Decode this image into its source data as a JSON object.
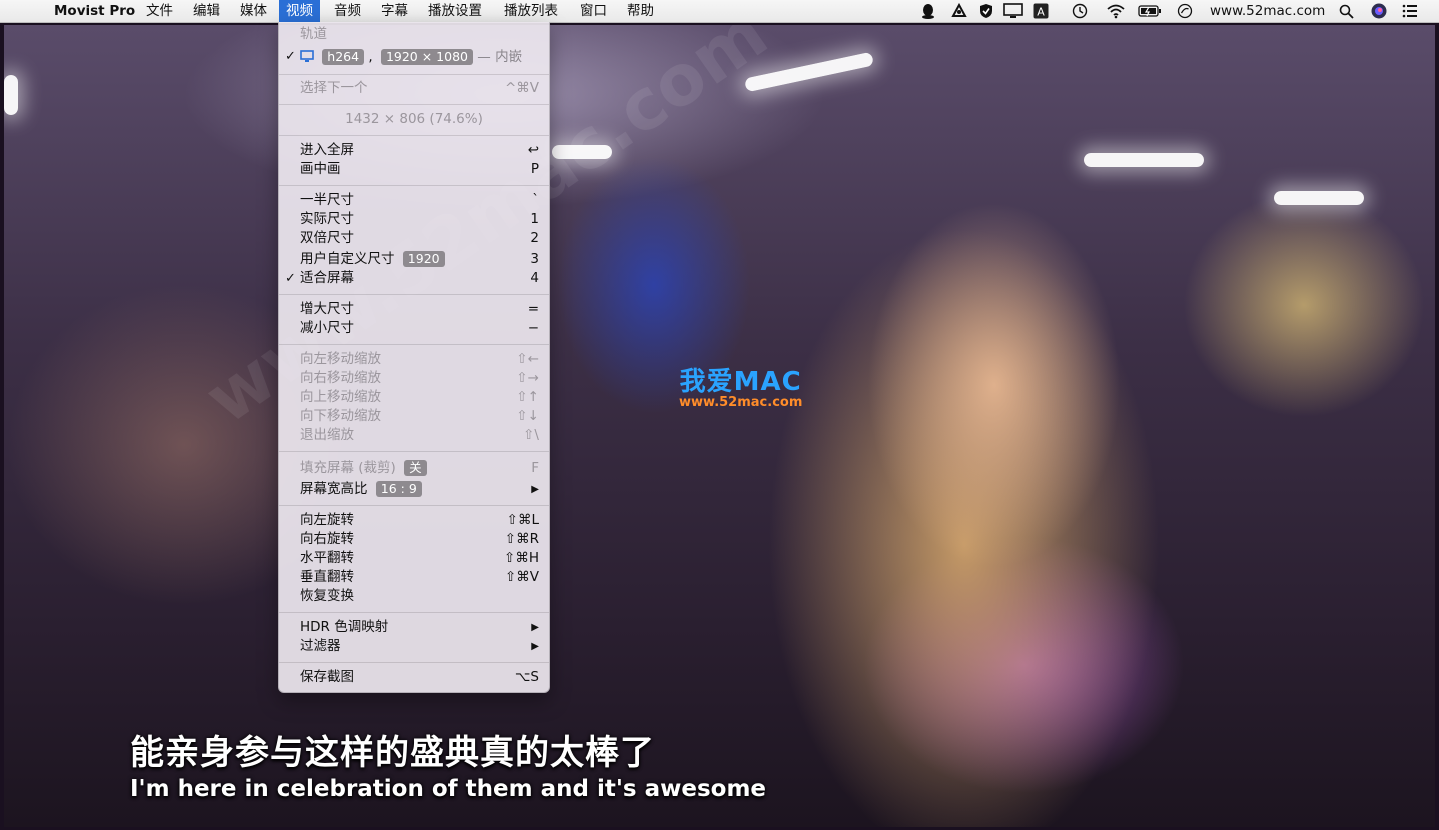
{
  "menubar": {
    "app_name": "Movist Pro",
    "menus": [
      "文件",
      "编辑",
      "媒体",
      "视频",
      "音频",
      "字幕",
      "播放设置",
      "播放列表",
      "窗口",
      "帮助"
    ],
    "active_menu": "视频",
    "site": "www.52mac.com",
    "status_icons": [
      "qq-icon",
      "app-icon",
      "shield-icon",
      "display-icon",
      "input-source-icon",
      "time-machine-icon",
      "wifi-icon",
      "battery-icon",
      "sync-icon",
      "search-icon",
      "siri-icon",
      "list-icon"
    ]
  },
  "video_menu": {
    "track_header": "轨道",
    "track": {
      "codec": "h264",
      "resolution": "1920 × 1080",
      "suffix": "— 内嵌"
    },
    "select_next": {
      "label": "选择下一个",
      "key": "^⌘V"
    },
    "size_info": "1432 × 806 (74.6%)",
    "fullscreen": {
      "label": "进入全屏",
      "key": "↩"
    },
    "pip": {
      "label": "画中画",
      "key": "P"
    },
    "half_size": {
      "label": "一半尺寸",
      "key": "`"
    },
    "actual_size": {
      "label": "实际尺寸",
      "key": "1"
    },
    "double_size": {
      "label": "双倍尺寸",
      "key": "2"
    },
    "custom_size": {
      "label": "用户自定义尺寸",
      "badge": "1920",
      "key": "3"
    },
    "fit_screen": {
      "label": "适合屏幕",
      "key": "4"
    },
    "increase_size": {
      "label": "增大尺寸",
      "key": "="
    },
    "decrease_size": {
      "label": "减小尺寸",
      "key": "−"
    },
    "move_left": {
      "label": "向左移动缩放",
      "key": "⇧←"
    },
    "move_right": {
      "label": "向右移动缩放",
      "key": "⇧→"
    },
    "move_up": {
      "label": "向上移动缩放",
      "key": "⇧↑"
    },
    "move_down": {
      "label": "向下移动缩放",
      "key": "⇧↓"
    },
    "exit_zoom": {
      "label": "退出缩放",
      "key": "⇧\\"
    },
    "fill_screen": {
      "label": "填充屏幕 (裁剪)",
      "badge": "关",
      "key": "F"
    },
    "aspect_ratio": {
      "label": "屏幕宽高比",
      "badge": "16 : 9",
      "key": "▶"
    },
    "rotate_left": {
      "label": "向左旋转",
      "key": "⇧⌘L"
    },
    "rotate_right": {
      "label": "向右旋转",
      "key": "⇧⌘R"
    },
    "flip_horizontal": {
      "label": "水平翻转",
      "key": "⇧⌘H"
    },
    "flip_vertical": {
      "label": "垂直翻转",
      "key": "⇧⌘V"
    },
    "restore_transform": {
      "label": "恢复变换"
    },
    "hdr_tone": {
      "label": "HDR 色调映射",
      "key": "▶"
    },
    "filters": {
      "label": "过滤器",
      "key": "▶"
    },
    "save_screenshot": {
      "label": "保存截图",
      "key": "⌥S"
    }
  },
  "video": {
    "watermark_top_a": "我爱",
    "watermark_top_b": "MAC",
    "watermark_sub": "www.52mac.com",
    "watermark_diag": "www.52mac.com",
    "subtitle_cn": "能亲身参与这样的盛典真的太棒了",
    "subtitle_en": "I'm here in celebration of them and it's awesome"
  }
}
